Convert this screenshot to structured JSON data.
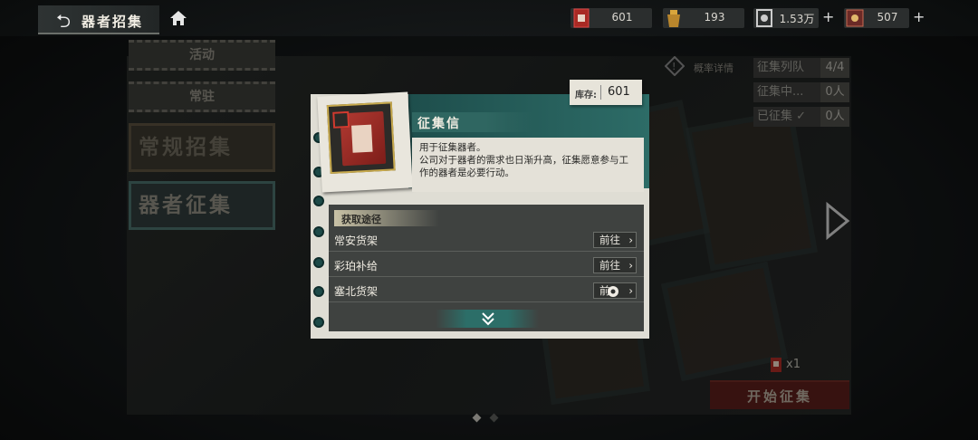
{
  "topbar": {
    "title": "器者招集",
    "resources": [
      {
        "icon": "letter-icon",
        "value": "601"
      },
      {
        "icon": "bag-icon",
        "value": "193"
      },
      {
        "icon": "coin-icon",
        "value": "1.53万"
      },
      {
        "icon": "ticket-icon",
        "value": "507"
      }
    ]
  },
  "left_tabs": {
    "activity": "活动",
    "permanent": "常驻",
    "regular": "常规招集",
    "collect": "器者征集"
  },
  "right_panel": {
    "rate_label": "概率详情",
    "chips": [
      {
        "label": "征集列队",
        "value": "4/4"
      },
      {
        "label": "征集中...",
        "value": "0人"
      },
      {
        "label": "已征集",
        "value": "0人"
      }
    ],
    "cost": "x1",
    "start_label": "开始征集"
  },
  "modal": {
    "stock_label": "库存:",
    "stock_value": "601",
    "item_name": "征集信",
    "description_line1": "用于征集器者。",
    "description_line2": "公司对于器者的需求也日渐升高，征集愿意参与工作的器者是必要行动。",
    "source_title": "获取途径",
    "sources": [
      {
        "name": "常安货架",
        "button": "前往"
      },
      {
        "name": "彩珀补给",
        "button": "前往"
      },
      {
        "name": "塞北货架",
        "button": "前"
      }
    ]
  }
}
